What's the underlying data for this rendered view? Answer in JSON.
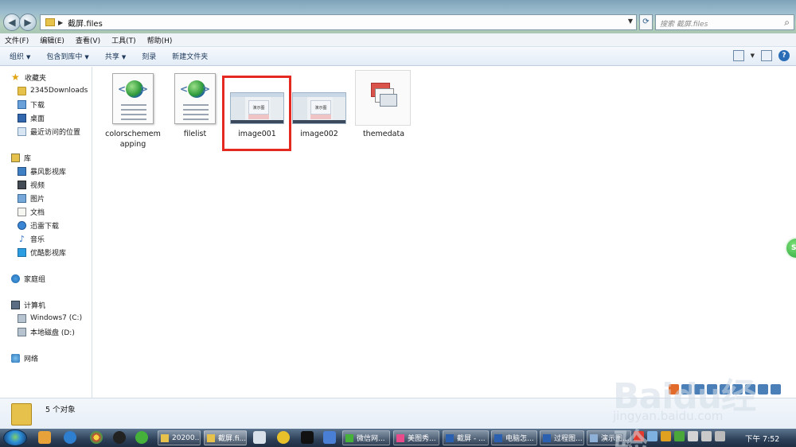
{
  "address": {
    "path": "截屏.files"
  },
  "search": {
    "placeholder": "搜索 截屏.files"
  },
  "menu": [
    "文件(F)",
    "编辑(E)",
    "查看(V)",
    "工具(T)",
    "帮助(H)"
  ],
  "toolbar": {
    "organize": "组织",
    "include_library": "包含到库中",
    "share": "共享",
    "burn": "刻录",
    "new_folder": "新建文件夹"
  },
  "nav": {
    "favorites": "收藏夹",
    "fav_items": [
      "2345Downloads",
      "下载",
      "桌面",
      "最近访问的位置"
    ],
    "libraries": "库",
    "lib_items": [
      "暴风影视库",
      "视频",
      "图片",
      "文档",
      "迅雷下载",
      "音乐",
      "优酷影视库"
    ],
    "homegroup": "家庭组",
    "computer": "计算机",
    "computer_items": [
      "Windows7 (C:)",
      "本地磁盘 (D:)"
    ],
    "network": "网络"
  },
  "files": [
    {
      "name": "colorschememapping",
      "type": "html"
    },
    {
      "name": "filelist",
      "type": "html"
    },
    {
      "name": "image001",
      "type": "image",
      "thumb_text": "演示图",
      "selected": true
    },
    {
      "name": "image002",
      "type": "image",
      "thumb_text": "演示图"
    },
    {
      "name": "themedata",
      "type": "theme"
    }
  ],
  "details": {
    "count": "5 个对象"
  },
  "taskbar": {
    "tasks": [
      "20200...",
      "截屏.fi...",
      "微信网...",
      "美图秀...",
      "截屏 - ...",
      "电脑怎...",
      "过程图...",
      "演示图..."
    ],
    "clock": "下午 7:52"
  },
  "overlay": {
    "side_button": "SI",
    "watermark": "Baidu经验",
    "watermark_url": "jingyan.baidu.com"
  },
  "colors": {
    "highlight_box": "#e42a20",
    "taskbar": "#2c3f57",
    "toolbar_bg": "#e3ecf6"
  }
}
